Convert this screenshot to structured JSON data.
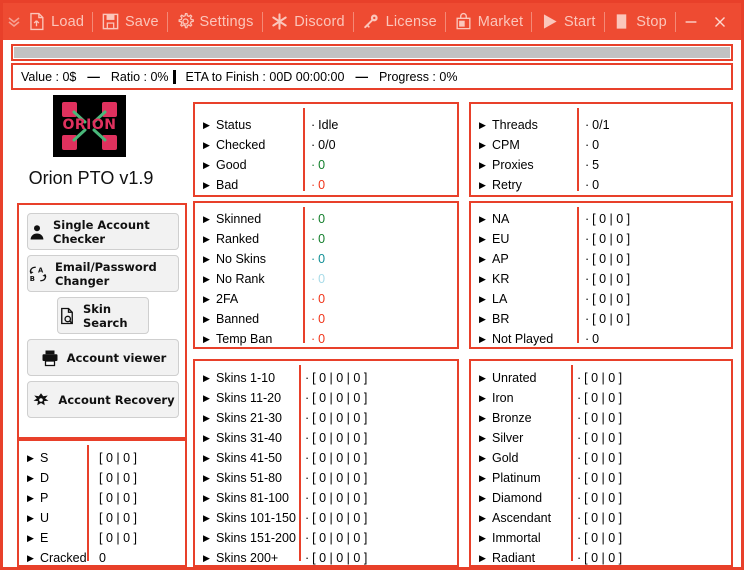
{
  "window": {
    "minimize_label": "—",
    "close_label": "✕",
    "expand_label": "﹀﹀"
  },
  "toolbar": {
    "items": [
      {
        "label": "Load",
        "icon": "load-icon"
      },
      {
        "label": "Save",
        "icon": "save-icon"
      },
      {
        "label": "Settings",
        "icon": "gear-icon"
      },
      {
        "label": "Discord",
        "icon": "discord-icon"
      },
      {
        "label": "License",
        "icon": "key-icon"
      },
      {
        "label": "Market",
        "icon": "market-icon"
      },
      {
        "label": "Start",
        "icon": "play-icon"
      },
      {
        "label": "Stop",
        "icon": "stop-icon"
      }
    ]
  },
  "progress": {
    "percent": 0
  },
  "statusbar": {
    "value": "Value : 0$",
    "dash1": "—",
    "ratio": "Ratio : 0%",
    "eta": "ETA to Finish : 00D 00:00:00",
    "dash2": "—",
    "progress": "Progress : 0%"
  },
  "branding": {
    "logo_text": "ORION",
    "app_title": "Orion PTO v1.9"
  },
  "sidebuttons": [
    {
      "label": "Single Account Checker",
      "icon": "person-icon"
    },
    {
      "label": "Email/Password Changer",
      "icon": "swap-ab-icon"
    },
    {
      "label": "Skin Search",
      "icon": "doc-search-icon"
    },
    {
      "label": "Account viewer",
      "icon": "printer-icon"
    },
    {
      "label": "Account Recovery",
      "icon": "eagle-icon"
    }
  ],
  "colors": {
    "accent": "#e8402a",
    "titlebar": "#ee4b32",
    "good": "#127e2b",
    "bad": "#f0341a",
    "teal": "#0f8f96",
    "lightblue": "#a8dbe8",
    "neutral": "#000000"
  },
  "panels": {
    "status": {
      "rows": [
        {
          "name": "Status",
          "value": "Idle",
          "color": "#000000"
        },
        {
          "name": "Checked",
          "value": "0/0",
          "color": "#000000"
        },
        {
          "name": "Good",
          "value": "0",
          "color": "#127e2b"
        },
        {
          "name": "Bad",
          "value": "0",
          "color": "#f0341a"
        }
      ]
    },
    "threads": {
      "rows": [
        {
          "name": "Threads",
          "value": "0/1",
          "color": "#000000"
        },
        {
          "name": "CPM",
          "value": "0",
          "color": "#000000"
        },
        {
          "name": "Proxies",
          "value": "5",
          "color": "#000000"
        },
        {
          "name": "Retry",
          "value": "0",
          "color": "#000000"
        }
      ]
    },
    "accountflags": {
      "rows": [
        {
          "name": "Skinned",
          "value": "0",
          "color": "#127e2b"
        },
        {
          "name": "Ranked",
          "value": "0",
          "color": "#127e2b"
        },
        {
          "name": "No Skins",
          "value": "0",
          "color": "#0f8f96"
        },
        {
          "name": "No Rank",
          "value": "0",
          "color": "#a8dbe8"
        },
        {
          "name": "2FA",
          "value": "0",
          "color": "#f0341a"
        },
        {
          "name": "Banned",
          "value": "0",
          "color": "#f0341a"
        },
        {
          "name": "Temp Ban",
          "value": "0",
          "color": "#f0341a"
        }
      ]
    },
    "regions": {
      "rows": [
        {
          "name": "NA",
          "value": "[ 0 | 0 ]",
          "color": "#000000"
        },
        {
          "name": "EU",
          "value": "[ 0 | 0 ]",
          "color": "#000000"
        },
        {
          "name": "AP",
          "value": "[ 0 | 0 ]",
          "color": "#000000"
        },
        {
          "name": "KR",
          "value": "[ 0 | 0 ]",
          "color": "#000000"
        },
        {
          "name": "LA",
          "value": "[ 0 | 0 ]",
          "color": "#000000"
        },
        {
          "name": "BR",
          "value": "[ 0 | 0 ]",
          "color": "#000000"
        },
        {
          "name": "Not Played",
          "value": "0",
          "color": "#000000"
        }
      ]
    },
    "skins": {
      "rows": [
        {
          "name": "Skins 1-10",
          "value": "[ 0 | 0 | 0 ]",
          "color": "#000000"
        },
        {
          "name": "Skins 11-20",
          "value": "[ 0 | 0 | 0 ]",
          "color": "#000000"
        },
        {
          "name": "Skins 21-30",
          "value": "[ 0 | 0 | 0 ]",
          "color": "#000000"
        },
        {
          "name": "Skins 31-40",
          "value": "[ 0 | 0 | 0 ]",
          "color": "#000000"
        },
        {
          "name": "Skins 41-50",
          "value": "[ 0 | 0 | 0 ]",
          "color": "#000000"
        },
        {
          "name": "Skins 51-80",
          "value": "[ 0 | 0 | 0 ]",
          "color": "#000000"
        },
        {
          "name": "Skins 81-100",
          "value": "[ 0 | 0 | 0 ]",
          "color": "#000000"
        },
        {
          "name": "Skins 101-150",
          "value": "[ 0 | 0 | 0 ]",
          "color": "#000000"
        },
        {
          "name": "Skins 151-200",
          "value": "[ 0 | 0 | 0 ]",
          "color": "#000000"
        },
        {
          "name": "Skins 200+",
          "value": "[ 0 | 0 | 0 ]",
          "color": "#000000"
        }
      ]
    },
    "ranks": {
      "rows": [
        {
          "name": "Unrated",
          "value": "[ 0 | 0 ]",
          "color": "#000000"
        },
        {
          "name": "Iron",
          "value": "[ 0 | 0 ]",
          "color": "#000000"
        },
        {
          "name": "Bronze",
          "value": "[ 0 | 0 ]",
          "color": "#000000"
        },
        {
          "name": "Silver",
          "value": "[ 0 | 0 ]",
          "color": "#000000"
        },
        {
          "name": "Gold",
          "value": "[ 0 | 0 ]",
          "color": "#000000"
        },
        {
          "name": "Platinum",
          "value": "[ 0 | 0 ]",
          "color": "#000000"
        },
        {
          "name": "Diamond",
          "value": "[ 0 | 0 ]",
          "color": "#000000"
        },
        {
          "name": "Ascendant",
          "value": "[ 0 | 0 ]",
          "color": "#000000"
        },
        {
          "name": "Immortal",
          "value": "[ 0 | 0 ]",
          "color": "#000000"
        },
        {
          "name": "Radiant",
          "value": "[ 0 | 0 ]",
          "color": "#000000"
        }
      ]
    },
    "capture": {
      "rows": [
        {
          "name": "S",
          "value": "[ 0 | 0 ]",
          "color": "#000000"
        },
        {
          "name": "D",
          "value": "[ 0 | 0 ]",
          "color": "#000000"
        },
        {
          "name": "P",
          "value": "[ 0 | 0 ]",
          "color": "#000000"
        },
        {
          "name": "U",
          "value": "[ 0 | 0 ]",
          "color": "#000000"
        },
        {
          "name": "E",
          "value": "[ 0 | 0 ]",
          "color": "#000000"
        },
        {
          "name": "Cracked",
          "value": "0",
          "color": "#000000"
        }
      ]
    }
  }
}
